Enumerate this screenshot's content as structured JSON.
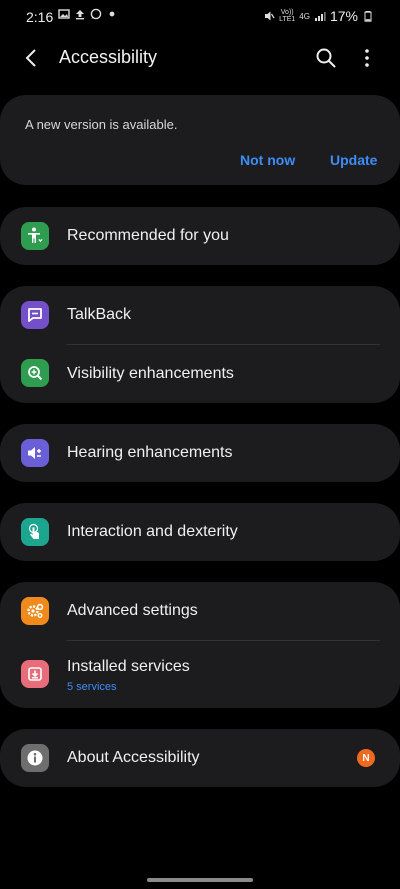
{
  "status_bar": {
    "time": "2:16",
    "battery": "17%",
    "signal_text_top": "Vo))",
    "signal_text_bottom": "LTE1",
    "network": "4G"
  },
  "app_bar": {
    "title": "Accessibility"
  },
  "update_banner": {
    "message": "A new version is available.",
    "not_now_label": "Not now",
    "update_label": "Update"
  },
  "items": {
    "recommended": "Recommended for you",
    "talkback": "TalkBack",
    "visibility": "Visibility enhancements",
    "hearing": "Hearing enhancements",
    "interaction": "Interaction and dexterity",
    "advanced": "Advanced settings",
    "installed": "Installed services",
    "installed_sub": "5 services",
    "about": "About Accessibility",
    "about_badge": "N"
  },
  "colors": {
    "accent": "#3e8df5",
    "card": "#1c1c1e",
    "recommended_icon": "#2e9d50",
    "talkback_icon": "#7350c9",
    "visibility_icon": "#2e9d50",
    "hearing_icon": "#6a5fd6",
    "interaction_icon": "#1ea58f",
    "advanced_icon": "#f08a1c",
    "installed_icon": "#e86d7a",
    "about_icon": "#6e6e6e",
    "badge": "#ef6a1f"
  },
  "icons": {
    "recommended": "person-heart-icon",
    "talkback": "chat-bubble-icon",
    "visibility": "zoom-in-icon",
    "hearing": "speaker-icon",
    "interaction": "touch-hand-icon",
    "advanced": "gears-icon",
    "installed": "download-box-icon",
    "about": "info-icon"
  }
}
